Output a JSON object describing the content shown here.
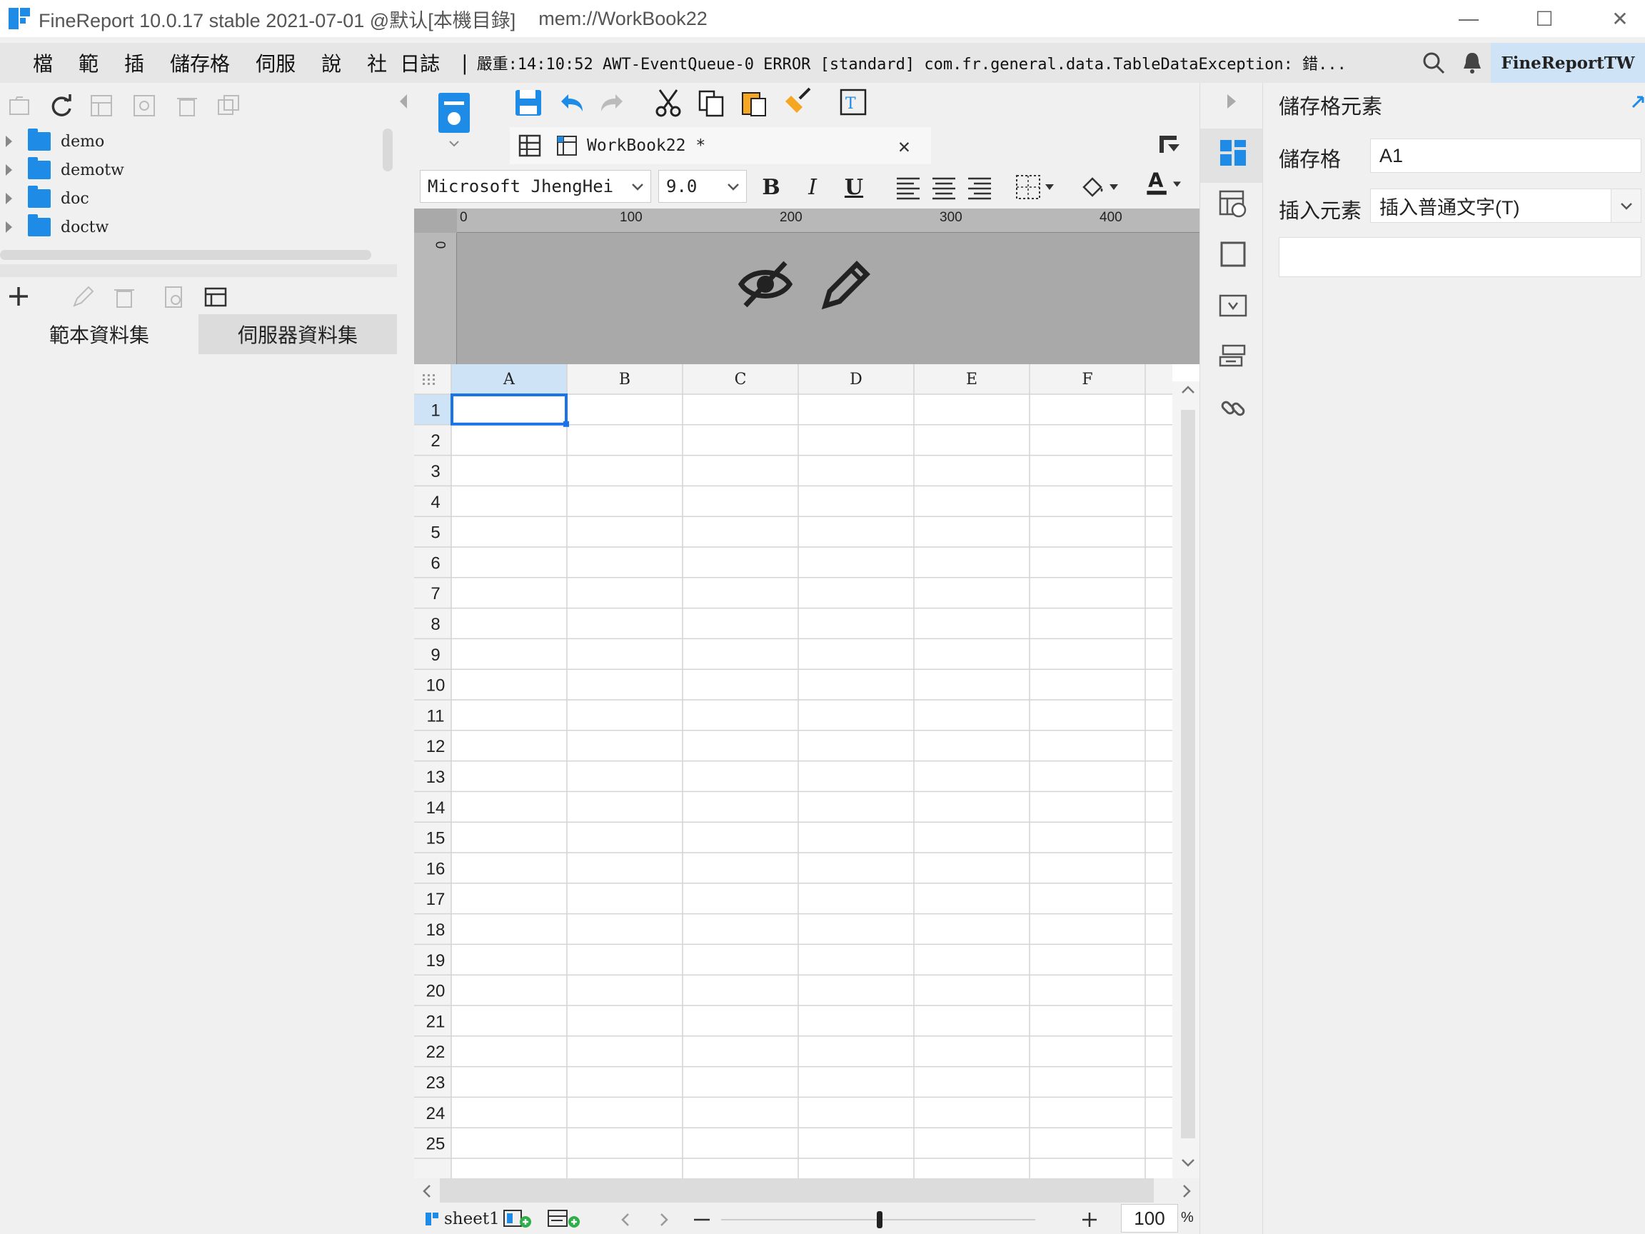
{
  "window": {
    "title": "FineReport 10.0.17 stable 2021-07-01 @默认[本機目錄]",
    "path": "mem://WorkBook22",
    "minimize": "—",
    "maximize": "☐",
    "close": "✕"
  },
  "menubar": {
    "items": [
      "檔",
      "範",
      "插",
      "儲存格",
      "伺服",
      "說",
      "社",
      "日誌"
    ],
    "log": "嚴重:14:10:52 AWT-EventQueue-0 ERROR [standard] com.fr.general.data.TableDataException: 錯...",
    "brand": "FineReportTW"
  },
  "left_panel": {
    "tree": [
      "demo",
      "demotw",
      "doc",
      "doctw"
    ],
    "tabs": [
      "範本資料集",
      "伺服器資料集"
    ]
  },
  "toolbar": {
    "doc_tab": "WorkBook22 *",
    "font_family": "Microsoft JhengHei",
    "font_size": "9.0",
    "bold": "B",
    "italic": "I",
    "underline": "U"
  },
  "ruler": {
    "labels": [
      "0",
      "100",
      "200",
      "300",
      "400"
    ],
    "v_label": "0"
  },
  "grid": {
    "columns": [
      "A",
      "B",
      "C",
      "D",
      "E",
      "F"
    ],
    "rows": [
      "1",
      "2",
      "3",
      "4",
      "5",
      "6",
      "7",
      "8",
      "9",
      "10",
      "11",
      "12",
      "13",
      "14",
      "15",
      "16",
      "17",
      "18",
      "19",
      "20",
      "21",
      "22",
      "23",
      "24",
      "25"
    ],
    "selected_cell": "A1"
  },
  "sheet_bar": {
    "sheet_name": "sheet1",
    "zoom": "100",
    "zoom_unit": "%"
  },
  "properties": {
    "title": "儲存格元素",
    "cell_label": "儲存格",
    "cell_value": "A1",
    "insert_label": "插入元素",
    "insert_value": "插入普通文字(T)"
  },
  "colors": {
    "accent": "#1e8be6",
    "selection": "#1a73e8",
    "header_selected": "#cfe3f7"
  }
}
